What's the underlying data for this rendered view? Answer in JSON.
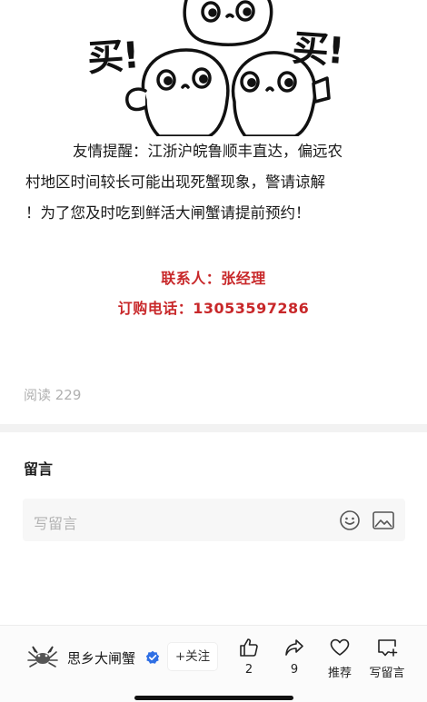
{
  "meme": {
    "left_text": "买!",
    "right_text": "买!"
  },
  "notice": {
    "line1": "友情提醒：江浙沪皖鲁顺丰直达，偏远农",
    "line2": "村地区时间较长可能出现死蟹现象，警请谅解",
    "line3": "！为了您及时吃到鲜活大闸蟹请提前预约！"
  },
  "contact": {
    "person": "联系人：张经理",
    "phone": "订购电话：13053597286"
  },
  "read_count": "阅读 229",
  "comments": {
    "title": "留言",
    "placeholder": "写留言"
  },
  "bottom_bar": {
    "account_name": "思乡大闸蟹",
    "follow_label": "+关注",
    "like_count": "2",
    "share_count": "9",
    "recommend_label": "推荐",
    "write_comment_label": "写留言"
  },
  "colors": {
    "contact_red": "#c8282a",
    "verified_blue": "#2f6fe4",
    "muted_gray": "#b0b0b0"
  },
  "icons": [
    "emoji-icon",
    "image-icon",
    "verified-icon",
    "thumbs-up-icon",
    "share-icon",
    "heart-icon",
    "comment-add-icon"
  ]
}
